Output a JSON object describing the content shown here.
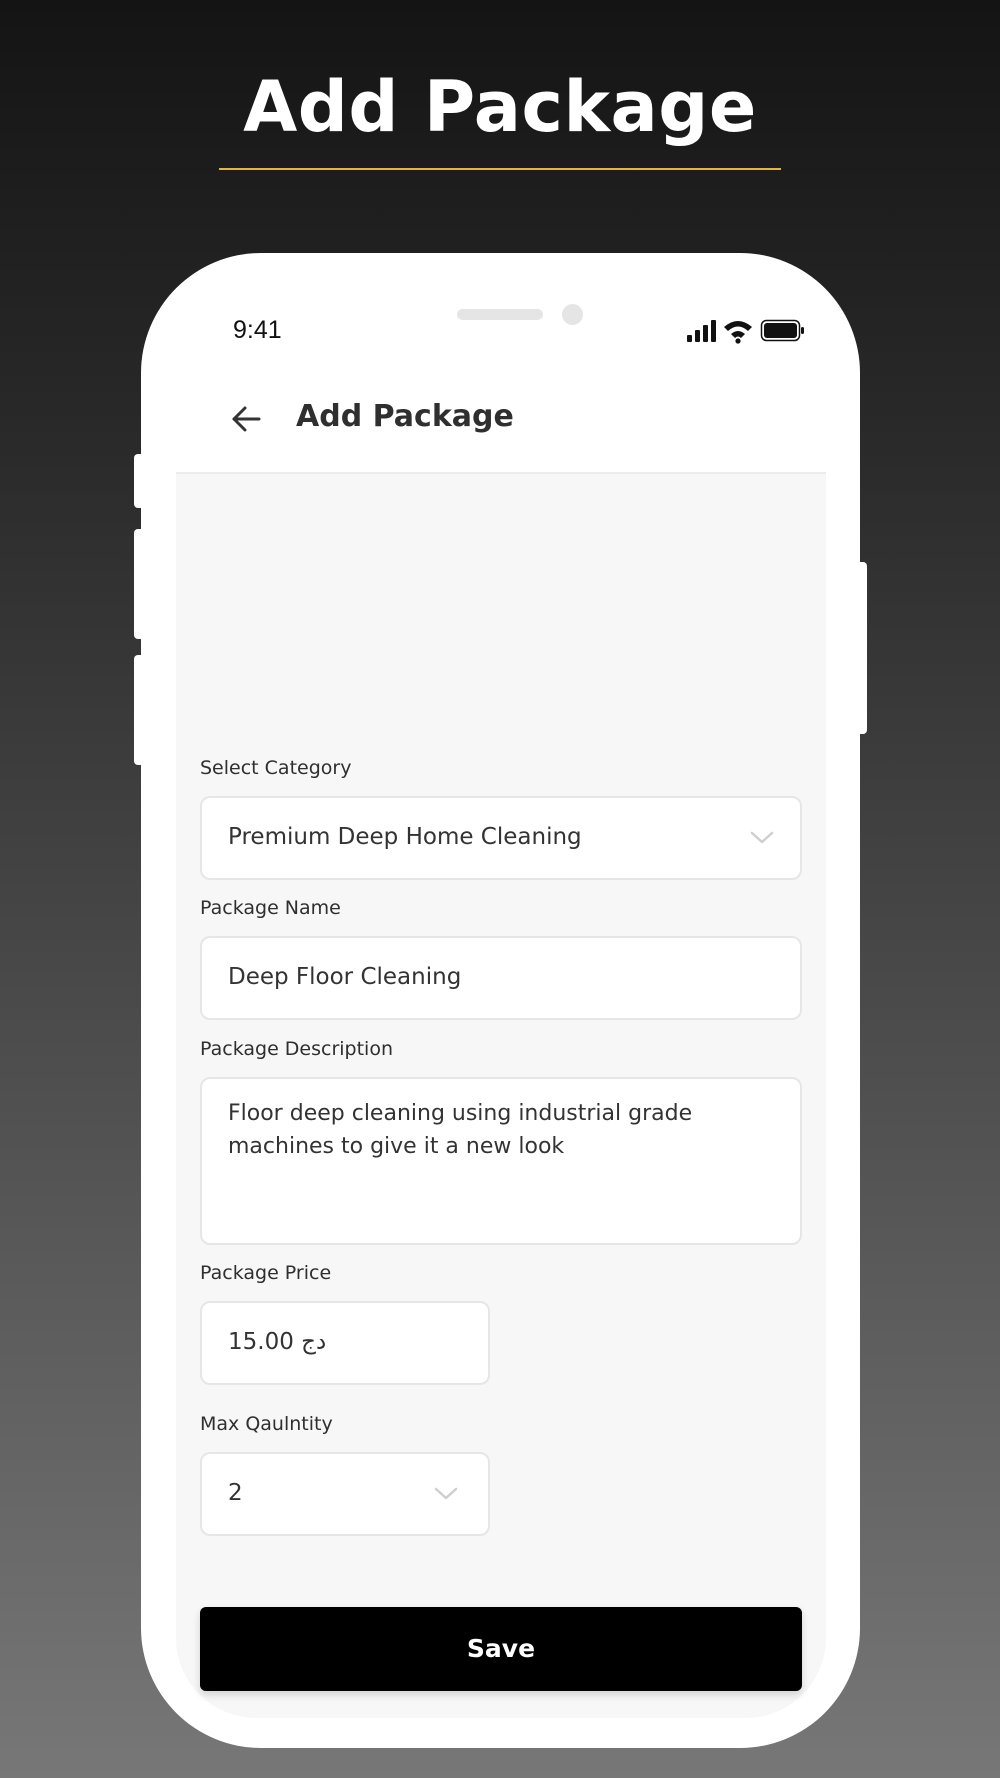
{
  "promo": {
    "title": "Add Package"
  },
  "status_bar": {
    "time": "9:41"
  },
  "header": {
    "title": "Add Package",
    "back_icon": "arrow-left-icon"
  },
  "form": {
    "category": {
      "label": "Select Category",
      "value": "Premium Deep Home Cleaning"
    },
    "package_name": {
      "label": "Package Name",
      "value": "Deep Floor Cleaning"
    },
    "description": {
      "label": "Package Description",
      "value": "Floor deep cleaning using industrial grade machines to give it a new look"
    },
    "price": {
      "label": "Package Price",
      "value": "15.00 دج"
    },
    "max_quantity": {
      "label": "Max Qaulntity",
      "value": "2"
    }
  },
  "actions": {
    "save_label": "Save"
  },
  "colors": {
    "accent_underline": "#e3b53a",
    "button_bg": "#000000",
    "screen_bg": "#f7f7f7"
  }
}
